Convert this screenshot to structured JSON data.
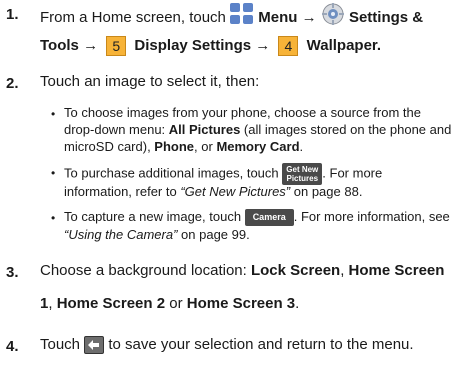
{
  "steps": [
    {
      "num": "1.",
      "line1": {
        "pre": "From a Home screen, touch",
        "menu_label": "Menu",
        "arrow1": "→",
        "settings_label": "Settings &"
      },
      "line2": {
        "tools": "Tools",
        "arrow2": "→",
        "num5": "5",
        "display_settings": "Display Settings",
        "arrow3": "→",
        "num4": "4",
        "wallpaper": "Wallpaper."
      }
    },
    {
      "num": "2.",
      "text": "Touch an image to select it, then:",
      "bullets": {
        "b1": {
          "l1": "To choose images from your phone, choose a source from the",
          "l2_pre": "drop-down menu: ",
          "l2_bold": "All Pictures",
          "l2_post": " (all images stored on the phone and",
          "l3_pre": "microSD card), ",
          "l3_phone": "Phone",
          "l3_mid": ", or ",
          "l3_memory": "Memory Card",
          "l3_end": "."
        },
        "b2": {
          "l1_pre": "To purchase additional images, touch",
          "btn_l1": "Get New",
          "btn_l2": "Pictures",
          "l1_post": ". For more",
          "l2_pre": "information, refer to ",
          "l2_ref": "“Get New Pictures”",
          "l2_post": " on page 88."
        },
        "b3": {
          "l1_pre": "To capture a new image, touch",
          "btn": "Camera",
          "l1_post": ". For more information, see",
          "l2_ref": "“Using the Camera”",
          "l2_post": " on page 99."
        }
      }
    },
    {
      "num": "3.",
      "l1_pre": "Choose a background location: ",
      "lock": "Lock Screen",
      "sep1": ", ",
      "home1a": "Home Screen",
      "home1b": "1",
      "sep2": ", ",
      "home2": "Home Screen 2",
      "or": " or ",
      "home3": "Home Screen 3",
      "end": "."
    },
    {
      "num": "4.",
      "pre": "Touch",
      "post": "to save your selection and return to the menu."
    }
  ],
  "icons": [
    "menu-grid-icon",
    "settings-gear-icon",
    "back-arrow-icon"
  ],
  "colors": {
    "menu_icon": "#5b82c8",
    "number_box": "#f7b338",
    "button_dark": "#4a4a4a"
  }
}
